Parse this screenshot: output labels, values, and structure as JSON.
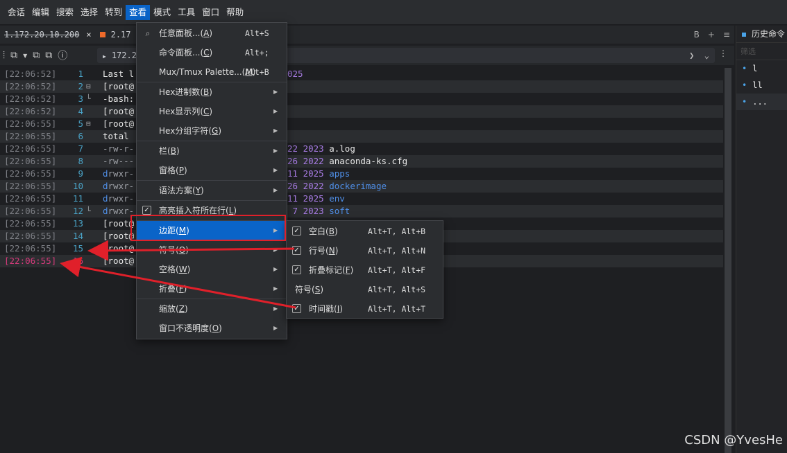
{
  "menubar": {
    "items": [
      "会话",
      "编辑",
      "搜索",
      "选择",
      "转到",
      "查看",
      "模式",
      "工具",
      "窗口",
      "帮助"
    ],
    "active_index": 5
  },
  "tabs": [
    {
      "label": "1.172.20.10.200",
      "close": "×"
    },
    {
      "label": "2.17"
    }
  ],
  "tab_right": {
    "b": "B",
    "plus": "+",
    "menu": "≡"
  },
  "toolbar": {
    "address": "172.2",
    "more": "⋮"
  },
  "terminal": {
    "rows": [
      {
        "ts": "[22:06:52]",
        "ln": "1",
        "fold": "",
        "text": "Last l",
        "tail": "025"
      },
      {
        "ts": "[22:06:52]",
        "ln": "2",
        "fold": "⊟",
        "text": "[root@",
        "tail": ""
      },
      {
        "ts": "[22:06:52]",
        "ln": "3",
        "fold": "└",
        "text": "-bash:",
        "tail": ""
      },
      {
        "ts": "[22:06:52]",
        "ln": "4",
        "fold": "",
        "text": "[root@",
        "tail": ""
      },
      {
        "ts": "[22:06:55]",
        "ln": "5",
        "fold": "⊟",
        "text": "[root@",
        "tail": ""
      },
      {
        "ts": "[22:06:55]",
        "ln": "6",
        "fold": "",
        "text": "total",
        "tail": ""
      },
      {
        "ts": "[22:06:55]",
        "ln": "7",
        "fold": "",
        "text": "-rw-r-",
        "tail_day": "22",
        "tail_year": "2023",
        "tail_name": "a.log",
        "tail_kind": "file"
      },
      {
        "ts": "[22:06:55]",
        "ln": "8",
        "fold": "",
        "text": "-rw---",
        "tail_day": "26",
        "tail_year": "2022",
        "tail_name": "anaconda-ks.cfg",
        "tail_kind": "file"
      },
      {
        "ts": "[22:06:55]",
        "ln": "9",
        "fold": "",
        "text": "drwxr-",
        "tail_day": "11",
        "tail_year": "2025",
        "tail_name": "apps",
        "tail_kind": "dir"
      },
      {
        "ts": "[22:06:55]",
        "ln": "10",
        "fold": "",
        "text": "drwxr-",
        "tail_day": "26",
        "tail_year": "2022",
        "tail_name": "dockerimage",
        "tail_kind": "dir"
      },
      {
        "ts": "[22:06:55]",
        "ln": "11",
        "fold": "",
        "text": "drwxr-",
        "tail_day": "11",
        "tail_year": "2025",
        "tail_name": "env",
        "tail_kind": "dir"
      },
      {
        "ts": "[22:06:55]",
        "ln": "12",
        "fold": "└",
        "text": "drwxr-",
        "tail_day": "7",
        "tail_year": "2023",
        "tail_name": "soft",
        "tail_kind": "dir"
      },
      {
        "ts": "[22:06:55]",
        "ln": "13",
        "fold": "",
        "text": "[root@",
        "tail": ""
      },
      {
        "ts": "[22:06:55]",
        "ln": "14",
        "fold": "",
        "text": "[root@",
        "tail": ""
      },
      {
        "ts": "[22:06:55]",
        "ln": "15",
        "fold": "",
        "text": "[root@",
        "tail": ""
      },
      {
        "ts": "[22:06:55]",
        "ln": "16",
        "fold": "",
        "text": "[root@",
        "tail": ""
      }
    ]
  },
  "history": {
    "title": "历史命令",
    "filter_placeholder": "筛选",
    "items": [
      "l",
      "ll",
      "..."
    ]
  },
  "view_menu": {
    "items": [
      {
        "label": "任意面板...",
        "key": "A",
        "shortcut": "Alt+S",
        "icon": "search-icon",
        "submenu": false
      },
      {
        "label": "命令面板...",
        "key": "C",
        "shortcut": "Alt+;",
        "submenu": false
      },
      {
        "label": "Mux/Tmux Palette...",
        "key": "M",
        "shortcut": "Alt+B",
        "submenu": false,
        "sep_after": true
      },
      {
        "label": "Hex进制数",
        "key": "B",
        "submenu": true
      },
      {
        "label": "Hex显示列",
        "key": "C",
        "submenu": true
      },
      {
        "label": "Hex分组字符",
        "key": "G",
        "submenu": true,
        "sep_after": true
      },
      {
        "label": "栏",
        "key": "B",
        "submenu": true
      },
      {
        "label": "窗格",
        "key": "P",
        "submenu": true,
        "sep_after": true
      },
      {
        "label": "语法方案",
        "key": "Y",
        "submenu": true,
        "sep_after": true
      },
      {
        "label": "高亮插入符所在行",
        "key": "L",
        "checked": true,
        "submenu": false,
        "sep_after": true
      },
      {
        "label": "边距",
        "key": "M",
        "submenu": true,
        "selected": true
      },
      {
        "label": "符号",
        "key": "O",
        "submenu": true
      },
      {
        "label": "空格",
        "key": "W",
        "submenu": true
      },
      {
        "label": "折叠",
        "key": "F",
        "submenu": true,
        "sep_after": true
      },
      {
        "label": "缩放",
        "key": "Z",
        "submenu": true
      },
      {
        "label": "窗口不透明度",
        "key": "O",
        "submenu": true
      }
    ]
  },
  "margin_submenu": {
    "items": [
      {
        "label": "空白",
        "key": "B",
        "shortcut": "Alt+T, Alt+B",
        "checked": true
      },
      {
        "label": "行号",
        "key": "N",
        "shortcut": "Alt+T, Alt+N",
        "checked": true
      },
      {
        "label": "折叠标记",
        "key": "F",
        "shortcut": "Alt+T, Alt+F",
        "checked": true
      },
      {
        "label": "符号",
        "key": "S",
        "shortcut": "Alt+T, Alt+S",
        "checked": false
      },
      {
        "label": "时间戳",
        "key": "I",
        "shortcut": "Alt+T, Alt+T",
        "checked": true
      }
    ]
  },
  "watermark": "CSDN @YvesHe",
  "colors": {
    "accent": "#0a64c8",
    "annotation": "#e0202a",
    "timestamp_pink": "#d63a7c"
  }
}
